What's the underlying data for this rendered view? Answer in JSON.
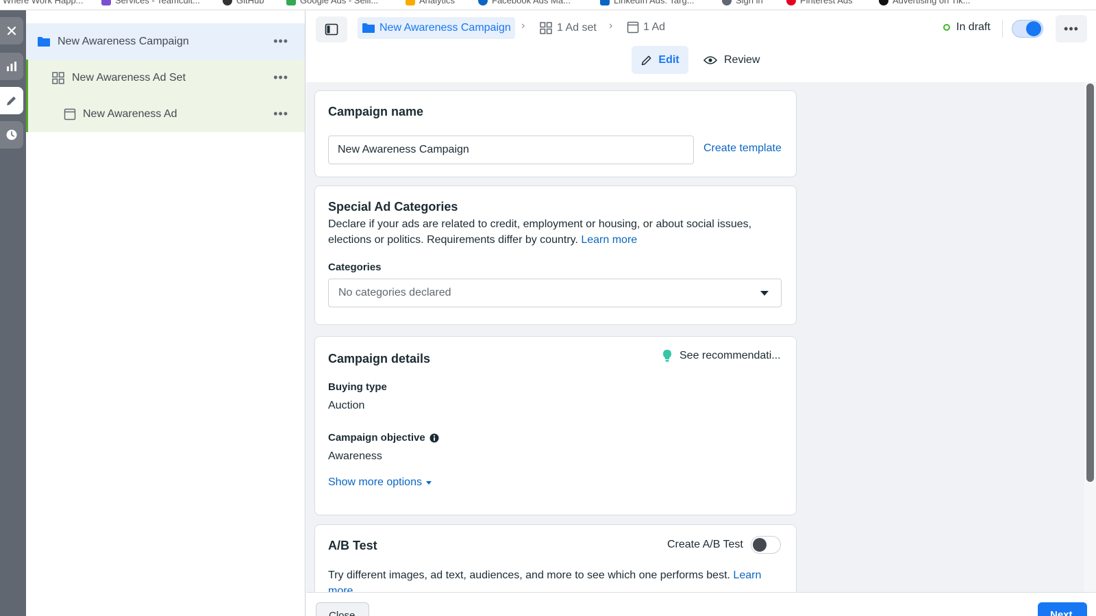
{
  "bookmarks": [
    {
      "label": "Where Work Happ...",
      "icon": "page-icon",
      "color": "#8a8d91"
    },
    {
      "label": "Services - Teamcult...",
      "icon": "calendar-icon",
      "color": "#7b4fd0"
    },
    {
      "label": "GitHub",
      "icon": "github-icon",
      "color": "#333333"
    },
    {
      "label": "Google Ads - Selli...",
      "icon": "google-ads-icon",
      "color": "#34a853"
    },
    {
      "label": "Analytics",
      "icon": "analytics-icon",
      "color": "#f9ab00"
    },
    {
      "label": "Facebook Ads Ma...",
      "icon": "meta-icon",
      "color": "#0a66c2"
    },
    {
      "label": "LinkedIn Ads: Targ...",
      "icon": "linkedin-icon",
      "color": "#0a66c2"
    },
    {
      "label": "Sign in",
      "icon": "globe-icon",
      "color": "#606770"
    },
    {
      "label": "Pinterest Ads",
      "icon": "pinterest-icon",
      "color": "#e60023"
    },
    {
      "label": "Advertising on Tik...",
      "icon": "tiktok-icon",
      "color": "#111111"
    }
  ],
  "rail": {
    "items": [
      "close-icon",
      "chart-icon",
      "pencil-icon",
      "clock-icon"
    ],
    "active": "pencil-icon"
  },
  "tree": {
    "campaign": {
      "label": "New Awareness Campaign",
      "more": "•••"
    },
    "adset": {
      "label": "New Awareness Ad Set",
      "more": "•••"
    },
    "ad": {
      "label": "New Awareness Ad",
      "more": "•••"
    }
  },
  "header": {
    "breadcrumb": {
      "campaign": "New Awareness Campaign",
      "adset": "1 Ad set",
      "ad": "1 Ad",
      "separator": "›"
    },
    "status": "In draft",
    "toggle_on": true,
    "more": "•••",
    "tabs": {
      "edit": "Edit",
      "review": "Review"
    }
  },
  "campaign_name": {
    "title": "Campaign name",
    "value": "New Awareness Campaign",
    "create_template": "Create template"
  },
  "special_ad": {
    "title": "Special Ad Categories",
    "description_line1": "Declare if your ads are related to credit, employment or housing, or about social issues,",
    "description_line2": "elections or politics. Requirements differ by country.",
    "learn_more": "Learn more",
    "categories_label": "Categories",
    "categories_value": "No categories declared"
  },
  "campaign_details": {
    "title": "Campaign details",
    "recommendations": "See recommendati...",
    "buying_type_label": "Buying type",
    "buying_type_value": "Auction",
    "objective_label": "Campaign objective",
    "objective_value": "Awareness",
    "show_more": "Show more options"
  },
  "ab_test": {
    "title": "A/B Test",
    "toggle_label": "Create A/B Test",
    "toggle_on": false,
    "description": "Try different images, ad text, audiences, and more to see which one performs best.",
    "learn": "Learn",
    "more": "more"
  },
  "footer": {
    "close": "Close",
    "next": "Next"
  },
  "colors": {
    "accent": "#1877f2",
    "link": "#0a66c2",
    "draft_dot": "#42b72a",
    "tree_green": "#5aa62c"
  }
}
